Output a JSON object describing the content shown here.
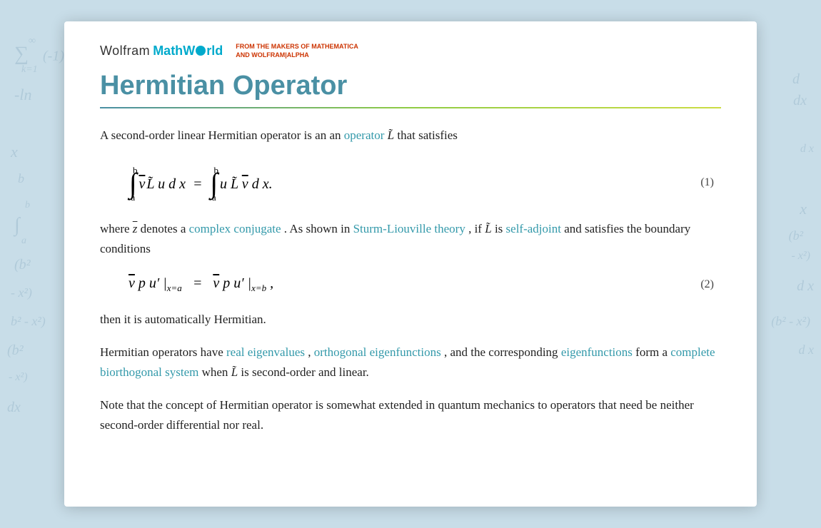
{
  "header": {
    "wolfram_label": "Wolfram",
    "mathworld_label": "MathWorld",
    "from_makers_line1": "FROM THE MAKERS OF MATHEMATICA",
    "from_makers_line2": "AND WOLFRAM|ALPHA"
  },
  "page": {
    "title": "Hermitian Operator"
  },
  "content": {
    "intro": "A second-order linear Hermitian operator is an",
    "intro_link": "operator",
    "intro_after": "that satisfies",
    "eq1_number": "(1)",
    "eq2_number": "(2)",
    "where_text": "where",
    "where_after": "denotes a",
    "complex_conjugate_link": "complex conjugate",
    "shown_text": ". As shown in",
    "sturm_link": "Sturm-Liouville theory",
    "if_text": ", if",
    "is_text": "is",
    "self_adjoint_link": "self-adjoint",
    "boundary_text": "and satisfies the boundary conditions",
    "then_text": "then it is automatically Hermitian.",
    "hermitian_ops_text": "Hermitian operators have",
    "real_eigen_link": "real eigenvalues",
    "orthogonal_link": "orthogonal eigenfunctions",
    "and_corresponding": ", and the corresponding",
    "eigenfunctions_link": "eigenfunctions",
    "form_text": "form a",
    "complete_link": "complete biorthogonal system",
    "when_text": "when",
    "second_order_text": "is second-order and linear.",
    "note_text": "Note that the concept of Hermitian operator is somewhat extended in quantum mechanics to operators that need be neither second-order differential nor real."
  }
}
